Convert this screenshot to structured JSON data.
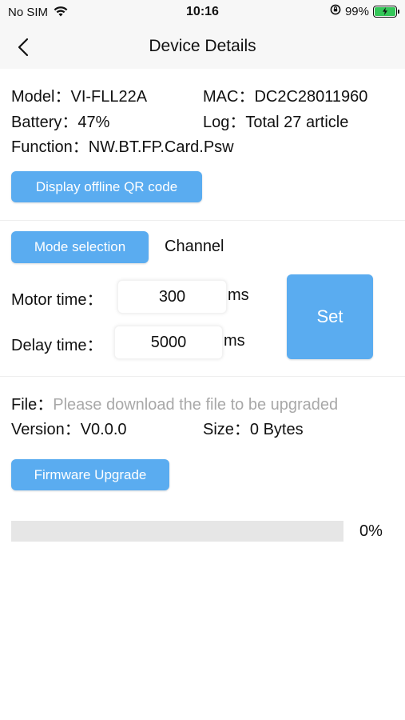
{
  "status_bar": {
    "carrier": "No SIM",
    "time": "10:16",
    "battery_percent": "99%",
    "battery_level": 0.99,
    "wifi_icon": "wifi-icon",
    "orientation_icon": "orientation-lock-icon"
  },
  "nav": {
    "title": "Device Details",
    "back_icon": "chevron-left-icon"
  },
  "device": {
    "model_label": "Model：",
    "model_value": "VI-FLL22A",
    "mac_label": "MAC：",
    "mac_value": "DC2C28011960",
    "battery_label": "Battery：",
    "battery_value": "47%",
    "log_label": "Log：",
    "log_value": "Total 27 article",
    "function_label": "Function：",
    "function_value": "NW.BT.FP.Card.Psw",
    "qr_button": "Display offline QR code"
  },
  "mode": {
    "mode_button": "Mode selection",
    "mode_value": "Channel",
    "motor_label": "Motor time：",
    "motor_value": "300",
    "motor_unit": "ms",
    "delay_label": "Delay time：",
    "delay_value": "5000",
    "delay_unit": "ms",
    "set_button": "Set"
  },
  "firmware": {
    "file_label": "File：",
    "file_placeholder": "Please download the file to be upgraded",
    "version_label": "Version：",
    "version_value": "V0.0.0",
    "size_label": "Size：",
    "size_value": "0 Bytes",
    "upgrade_button": "Firmware Upgrade",
    "progress_text": "0%",
    "progress_level": 0
  },
  "colors": {
    "accent": "#5aacf0",
    "battery_green": "#34c759"
  }
}
